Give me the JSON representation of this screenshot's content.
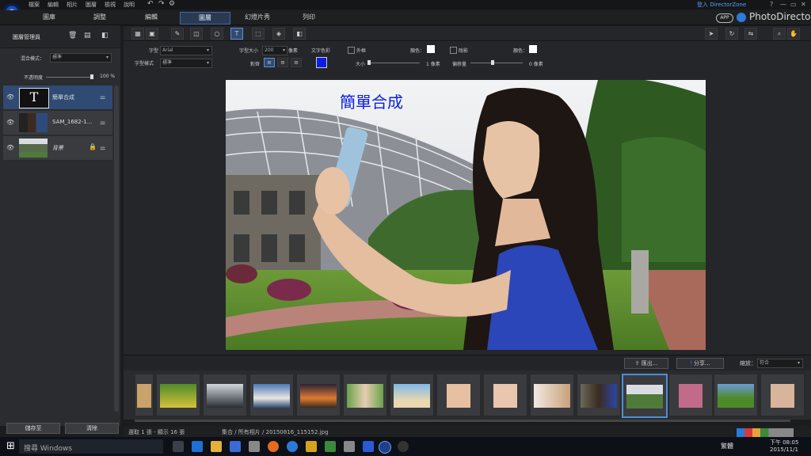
{
  "menu": [
    "檔案",
    "編輯",
    "相片",
    "圖層",
    "檢視",
    "說明"
  ],
  "modes": [
    "圖庫",
    "調整",
    "編輯",
    "圖層",
    "幻燈片秀",
    "列印"
  ],
  "login": "登入 DirectorZone",
  "window_controls": [
    "?",
    "—",
    "▭",
    "✕"
  ],
  "app_badge": "APP",
  "brand": "PhotoDirector",
  "panel": {
    "title": "圖層管理員",
    "blend_label": "混合模式：",
    "blend_value": "標準",
    "opacity_label": "不透明度",
    "opacity_value": "100 %",
    "opacity_fraction": 1.0,
    "layers": [
      {
        "name": "簡單合成",
        "type": "text"
      },
      {
        "name": "SAM_1682-1...",
        "type": "image"
      },
      {
        "name": "背景",
        "type": "background"
      }
    ],
    "save_btn": "儲存至",
    "clear_btn": "清除"
  },
  "props": {
    "font_label": "字型",
    "font_value": "Arial",
    "style_label": "字型樣式",
    "style_value": "標準",
    "size_label": "字型大小",
    "size_value": "200",
    "size_unit": "像素",
    "color_label": "文字色彩",
    "text_color": "#0a1ee8",
    "align_label": "對齊",
    "outline_label": "外框",
    "outline_color_label": "顏色：",
    "outline_size_label": "大小",
    "outline_size_value": "1 像素",
    "shadow_label": "陰影",
    "shadow_color_label": "顏色：",
    "shadow_offset_label": "偏移量",
    "shadow_offset_value": "0 像素"
  },
  "canvas": {
    "overlay_text": "簡單合成"
  },
  "filmbar": {
    "export_btn": "匯出...",
    "share_btn": "分享...",
    "zoom_label": "縮放：",
    "zoom_value": "符合"
  },
  "status": {
    "selection": "選取 1 張 - 顯示 16 張",
    "path": "集合 / 所有相片 / 20150816_115152.jpg"
  },
  "taskbar": {
    "search_placeholder": "搜尋 Windows",
    "time": "下午 08:05",
    "date": "2015/11/1",
    "lang": "繁體"
  }
}
